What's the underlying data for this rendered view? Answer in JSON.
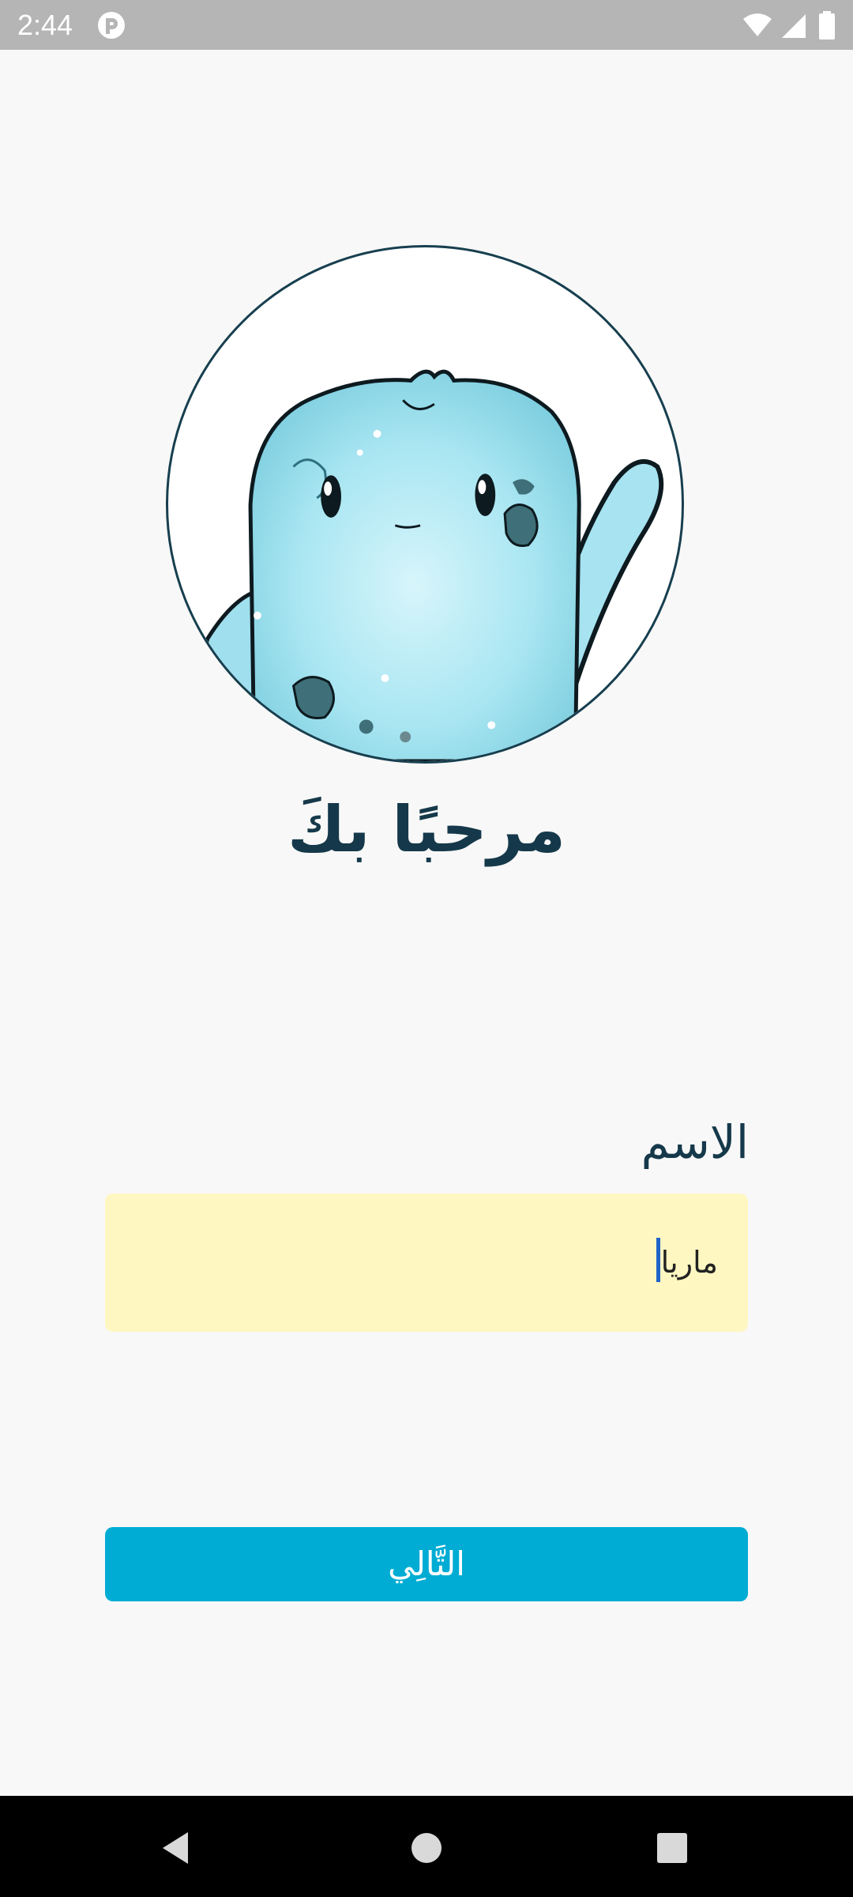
{
  "status_bar": {
    "time": "2:44",
    "icons": [
      "app-notification-icon",
      "wifi-icon",
      "signal-icon",
      "battery-icon"
    ]
  },
  "welcome": {
    "title": "مرحبًا بكَ"
  },
  "form": {
    "name_label": "الاسم",
    "name_value": "ماريا"
  },
  "actions": {
    "next_label": "التَّالِي"
  },
  "colors": {
    "primary_text": "#15394a",
    "input_background": "#fff7c2",
    "button_background": "#00acd4",
    "avatar_border": "#173f4f"
  },
  "nav_bar": {
    "buttons": [
      "back-icon",
      "home-icon",
      "recents-icon"
    ]
  }
}
